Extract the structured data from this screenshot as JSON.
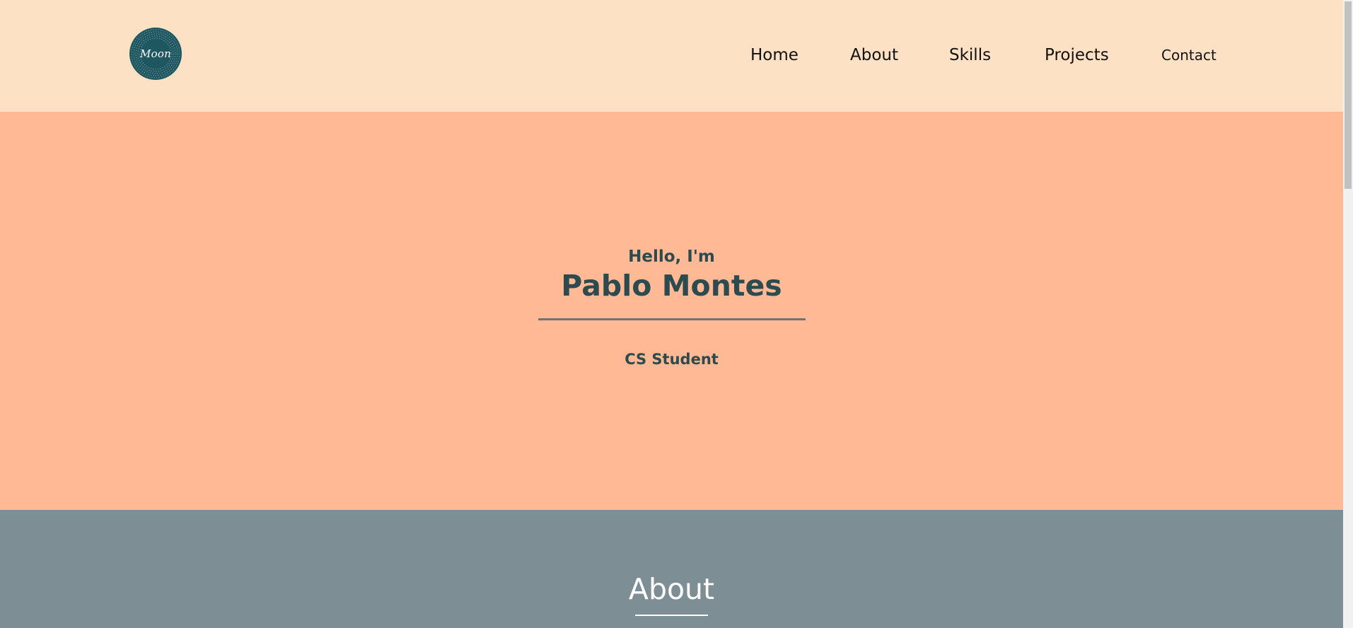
{
  "logo": {
    "text": "Moon",
    "color": "#1f5761"
  },
  "nav": {
    "items": [
      {
        "label": "Home"
      },
      {
        "label": "About"
      },
      {
        "label": "Skills"
      },
      {
        "label": "Projects"
      },
      {
        "label": "Contact"
      }
    ]
  },
  "hero": {
    "greeting": "Hello, I'm",
    "name": "Pablo Montes",
    "role": "CS Student"
  },
  "about": {
    "title": "About"
  },
  "colors": {
    "header_bg": "#fce1c4",
    "hero_bg": "#ffb994",
    "about_bg": "#7e8e95",
    "text_dark": "#2d4a4f"
  }
}
